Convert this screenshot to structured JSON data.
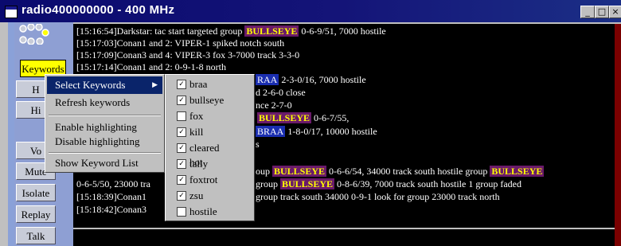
{
  "window": {
    "title": "radio400000000 - 400 MHz",
    "minimize": "_",
    "maximize": "□",
    "close": "×"
  },
  "buttons": {
    "keywords": "Keywords",
    "b2": "H",
    "b3": "Hi",
    "vol": "Vo",
    "mute": "Mute",
    "isolate": "Isolate",
    "replay": "Replay",
    "talk": "Talk"
  },
  "log": {
    "l1a": "[15:16:54]Darkstar: tac start targeted group ",
    "l1b": "BULLSEYE",
    "l1c": " 0-6-9/51, 7000 hostile",
    "l2": "[15:17:03]Conan1 and 2: VIPER-1 spiked notch south",
    "l3": "[15:17:09]Conan3 and 4: VIPER-3 fox 3-7000 track 3-3-0",
    "l4": "[15:17:14]Conan1 and 2: 0-9-1-8 north",
    "l5a": "RAA",
    "l5b": " 2-3-0/16, 7000 hostile",
    "l6": "d 2-6-0 close",
    "l7": "nce 2-7-0",
    "l8a": "BULLSEYE",
    "l8b": " 0-6-7/55,",
    "l9a": "BRAA",
    "l9b": " 1-8-0/17, 10000 hostile",
    "l10": "s",
    "l11a": "oup ",
    "l11b": "BULLSEYE",
    "l11c": " 0-6-6/54, 34000 track south hostile group ",
    "l11d": "BULLSEYE",
    "l12a": "0-6-5/50, 23000 tra",
    "l12b": "group ",
    "l12c": "BULLSEYE",
    "l12d": " 0-8-6/39, 7000 track south hostile 1 group faded",
    "l13a": "[15:18:39]Conan1",
    "l13b": "group track south 34000 0-9-1 look for group 23000 track north",
    "l14": "[15:18:42]Conan3"
  },
  "menu": {
    "select_keywords": "Select Keywords",
    "refresh_keywords": "Refresh keywords",
    "enable_highlighting": "Enable highlighting",
    "disable_highlighting": "Disable highlighting",
    "show_keyword_list": "Show Keyword List"
  },
  "keywords": [
    {
      "label": "braa",
      "checked": true
    },
    {
      "label": "bullseye",
      "checked": true
    },
    {
      "label": "fox",
      "checked": false
    },
    {
      "label": "kill",
      "checked": true
    },
    {
      "label": "cleared hot",
      "checked": true
    },
    {
      "label": "tally",
      "checked": true
    },
    {
      "label": "foxtrot",
      "checked": true
    },
    {
      "label": "zsu",
      "checked": true
    },
    {
      "label": "hostile",
      "checked": false
    }
  ],
  "colors": {
    "highlight_bg": "#6a1a6a",
    "highlight_fg": "#ffff00",
    "title_bar": "#0a0a6e",
    "menu_selected": "#0a246a"
  }
}
